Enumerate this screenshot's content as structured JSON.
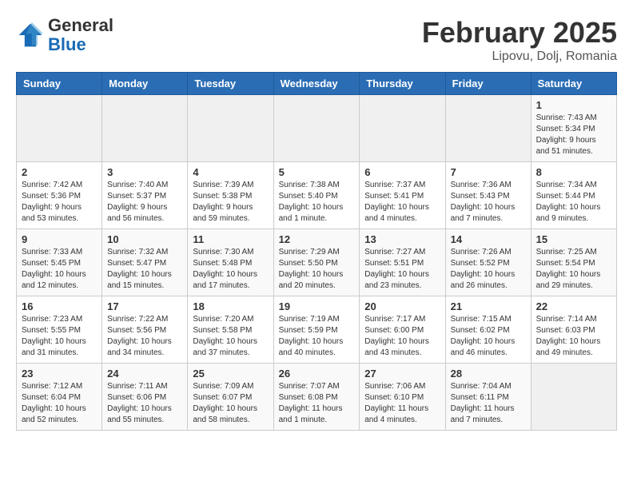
{
  "header": {
    "logo_general": "General",
    "logo_blue": "Blue",
    "title": "February 2025",
    "subtitle": "Lipovu, Dolj, Romania"
  },
  "weekdays": [
    "Sunday",
    "Monday",
    "Tuesday",
    "Wednesday",
    "Thursday",
    "Friday",
    "Saturday"
  ],
  "weeks": [
    [
      {
        "day": "",
        "info": ""
      },
      {
        "day": "",
        "info": ""
      },
      {
        "day": "",
        "info": ""
      },
      {
        "day": "",
        "info": ""
      },
      {
        "day": "",
        "info": ""
      },
      {
        "day": "",
        "info": ""
      },
      {
        "day": "1",
        "info": "Sunrise: 7:43 AM\nSunset: 5:34 PM\nDaylight: 9 hours and 51 minutes."
      }
    ],
    [
      {
        "day": "2",
        "info": "Sunrise: 7:42 AM\nSunset: 5:36 PM\nDaylight: 9 hours and 53 minutes."
      },
      {
        "day": "3",
        "info": "Sunrise: 7:40 AM\nSunset: 5:37 PM\nDaylight: 9 hours and 56 minutes."
      },
      {
        "day": "4",
        "info": "Sunrise: 7:39 AM\nSunset: 5:38 PM\nDaylight: 9 hours and 59 minutes."
      },
      {
        "day": "5",
        "info": "Sunrise: 7:38 AM\nSunset: 5:40 PM\nDaylight: 10 hours and 1 minute."
      },
      {
        "day": "6",
        "info": "Sunrise: 7:37 AM\nSunset: 5:41 PM\nDaylight: 10 hours and 4 minutes."
      },
      {
        "day": "7",
        "info": "Sunrise: 7:36 AM\nSunset: 5:43 PM\nDaylight: 10 hours and 7 minutes."
      },
      {
        "day": "8",
        "info": "Sunrise: 7:34 AM\nSunset: 5:44 PM\nDaylight: 10 hours and 9 minutes."
      }
    ],
    [
      {
        "day": "9",
        "info": "Sunrise: 7:33 AM\nSunset: 5:45 PM\nDaylight: 10 hours and 12 minutes."
      },
      {
        "day": "10",
        "info": "Sunrise: 7:32 AM\nSunset: 5:47 PM\nDaylight: 10 hours and 15 minutes."
      },
      {
        "day": "11",
        "info": "Sunrise: 7:30 AM\nSunset: 5:48 PM\nDaylight: 10 hours and 17 minutes."
      },
      {
        "day": "12",
        "info": "Sunrise: 7:29 AM\nSunset: 5:50 PM\nDaylight: 10 hours and 20 minutes."
      },
      {
        "day": "13",
        "info": "Sunrise: 7:27 AM\nSunset: 5:51 PM\nDaylight: 10 hours and 23 minutes."
      },
      {
        "day": "14",
        "info": "Sunrise: 7:26 AM\nSunset: 5:52 PM\nDaylight: 10 hours and 26 minutes."
      },
      {
        "day": "15",
        "info": "Sunrise: 7:25 AM\nSunset: 5:54 PM\nDaylight: 10 hours and 29 minutes."
      }
    ],
    [
      {
        "day": "16",
        "info": "Sunrise: 7:23 AM\nSunset: 5:55 PM\nDaylight: 10 hours and 31 minutes."
      },
      {
        "day": "17",
        "info": "Sunrise: 7:22 AM\nSunset: 5:56 PM\nDaylight: 10 hours and 34 minutes."
      },
      {
        "day": "18",
        "info": "Sunrise: 7:20 AM\nSunset: 5:58 PM\nDaylight: 10 hours and 37 minutes."
      },
      {
        "day": "19",
        "info": "Sunrise: 7:19 AM\nSunset: 5:59 PM\nDaylight: 10 hours and 40 minutes."
      },
      {
        "day": "20",
        "info": "Sunrise: 7:17 AM\nSunset: 6:00 PM\nDaylight: 10 hours and 43 minutes."
      },
      {
        "day": "21",
        "info": "Sunrise: 7:15 AM\nSunset: 6:02 PM\nDaylight: 10 hours and 46 minutes."
      },
      {
        "day": "22",
        "info": "Sunrise: 7:14 AM\nSunset: 6:03 PM\nDaylight: 10 hours and 49 minutes."
      }
    ],
    [
      {
        "day": "23",
        "info": "Sunrise: 7:12 AM\nSunset: 6:04 PM\nDaylight: 10 hours and 52 minutes."
      },
      {
        "day": "24",
        "info": "Sunrise: 7:11 AM\nSunset: 6:06 PM\nDaylight: 10 hours and 55 minutes."
      },
      {
        "day": "25",
        "info": "Sunrise: 7:09 AM\nSunset: 6:07 PM\nDaylight: 10 hours and 58 minutes."
      },
      {
        "day": "26",
        "info": "Sunrise: 7:07 AM\nSunset: 6:08 PM\nDaylight: 11 hours and 1 minute."
      },
      {
        "day": "27",
        "info": "Sunrise: 7:06 AM\nSunset: 6:10 PM\nDaylight: 11 hours and 4 minutes."
      },
      {
        "day": "28",
        "info": "Sunrise: 7:04 AM\nSunset: 6:11 PM\nDaylight: 11 hours and 7 minutes."
      },
      {
        "day": "",
        "info": ""
      }
    ]
  ]
}
